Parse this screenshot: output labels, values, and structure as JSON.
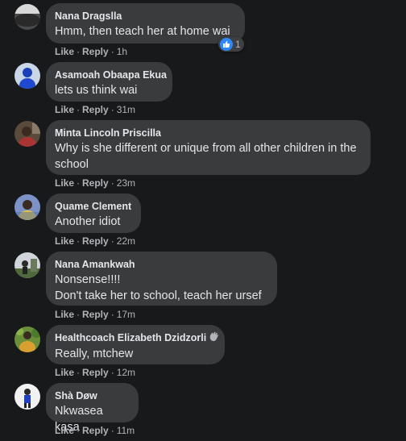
{
  "comments": [
    {
      "author": "Nana Dragslla",
      "text": "Hmm, then teach her at home wai",
      "like": "Like",
      "reply": "Reply",
      "time": "1h",
      "reaction_count": "1",
      "avatar": "gray-avatar"
    },
    {
      "author": "Asamoah Obaapa Ekua",
      "text": "lets us think wai",
      "like": "Like",
      "reply": "Reply",
      "time": "31m",
      "avatar": "blue-avatar"
    },
    {
      "author": "Minta Lincoln Priscilla",
      "text": "Why is she different or unique from all other children in the school",
      "like": "Like",
      "reply": "Reply",
      "time": "23m",
      "avatar": "photo-avatar"
    },
    {
      "author": "Quame Clement",
      "text": "Another idiot",
      "like": "Like",
      "reply": "Reply",
      "time": "22m",
      "avatar": "photo-avatar"
    },
    {
      "author": "Nana Amankwah",
      "text": "Nonsense!!!!\nDon't take her to school, teach her ursef",
      "like": "Like",
      "reply": "Reply",
      "time": "17m",
      "avatar": "photo-avatar"
    },
    {
      "author": "Healthcoach Elizabeth Dzidzorli",
      "text": "Really, mtchew",
      "like": "Like",
      "reply": "Reply",
      "time": "12m",
      "avatar": "photo-avatar",
      "badge": "waving-hand-icon"
    },
    {
      "author": "Shà Døw",
      "text": "Nkwasea kasa",
      "like": "Like",
      "reply": "Reply",
      "time": "11m",
      "avatar": "photo-avatar"
    }
  ],
  "colors": {
    "background": "#18191a",
    "bubble": "#3a3b3c",
    "muted": "#b0b3b8",
    "like_blue": "#2d88ff"
  }
}
